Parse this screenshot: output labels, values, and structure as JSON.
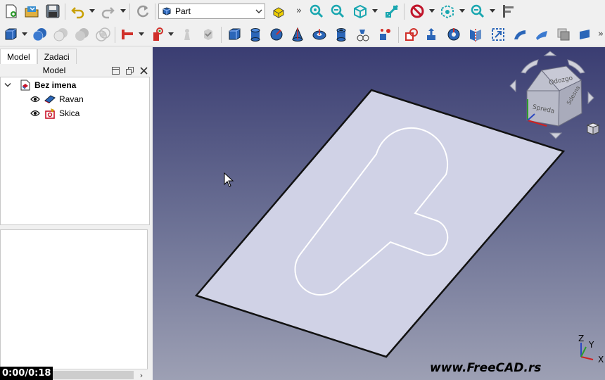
{
  "toolbar": {
    "workbench_selector": {
      "value": "Part"
    },
    "overflow_label": "»"
  },
  "left_panel": {
    "tabs": [
      {
        "label": "Model"
      },
      {
        "label": "Zadaci"
      }
    ],
    "model_header": {
      "title": "Model"
    },
    "tree": {
      "document": {
        "label": "Bez imena"
      },
      "children": [
        {
          "label": "Ravan"
        },
        {
          "label": "Skica"
        }
      ]
    },
    "playback_time": "0:00/0:18"
  },
  "view3d": {
    "navcube_faces": {
      "top": "Odozgo",
      "front": "Spreda",
      "right": "Sdesna"
    },
    "axis_labels": {
      "x": "X",
      "y": "Y",
      "z": "Z"
    },
    "watermark": "www.FreeCAD.rs"
  },
  "colors": {
    "plane": "#d0d2e6",
    "sketch": "#ffffff",
    "view_top": "#3a3d72",
    "view_bottom": "#9da0b4"
  }
}
